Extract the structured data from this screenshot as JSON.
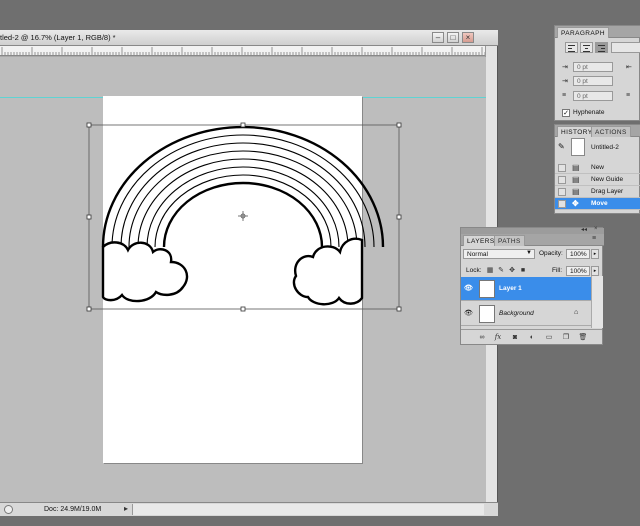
{
  "document": {
    "title": "tled-2 @ 16.7% (Layer 1, RGB/8) *",
    "status": "Doc: 24.9M/19.0M",
    "window_buttons": [
      "minimize",
      "restore",
      "close"
    ]
  },
  "panels": {
    "paragraph": {
      "tab": "PARAGRAPH",
      "indent_left": "0 pt",
      "indent_right": "0 pt",
      "indent_first": "0 pt",
      "space_before": "0 pt",
      "space_after": "0 pt",
      "hyphenate_label": "Hyphenate",
      "hyphenate_checked": true
    },
    "history": {
      "tabs": [
        "HISTORY",
        "ACTIONS"
      ],
      "snapshot": "Untitled-2",
      "items": [
        "New",
        "New Guide",
        "Drag Layer",
        "Move"
      ],
      "selected": "Move"
    },
    "layers": {
      "tabs": [
        "LAYERS",
        "PATHS"
      ],
      "blend_mode": "Normal",
      "opacity_label": "Opacity:",
      "opacity": "100%",
      "lock_label": "Lock:",
      "fill_label": "Fill:",
      "fill": "100%",
      "layers": [
        {
          "name": "Layer 1",
          "selected": true
        },
        {
          "name": "Background",
          "selected": false
        }
      ],
      "footer_icons": [
        "link-icon",
        "fx-icon",
        "mask-icon",
        "adjustment-icon",
        "group-icon",
        "new-layer-icon",
        "trash-icon"
      ]
    }
  },
  "colors": {
    "selection": "#3a8dea",
    "guide": "#5fd3d3",
    "workspace": "#6f6f6f"
  }
}
